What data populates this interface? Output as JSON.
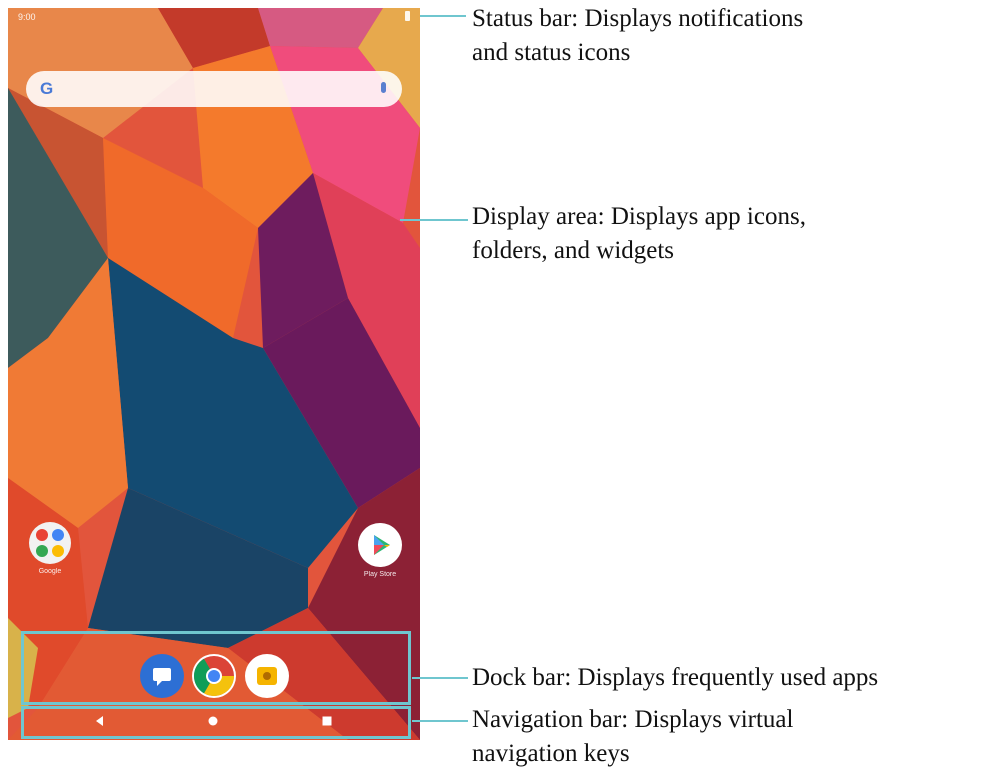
{
  "phone": {
    "status_bar": {
      "time": "9:00"
    },
    "apps": [
      {
        "id": "folder",
        "label": "Google"
      },
      {
        "id": "play-store",
        "label": "Play Store"
      }
    ],
    "dock": [
      {
        "id": "messages-icon"
      },
      {
        "id": "chrome-icon"
      },
      {
        "id": "gallery-icon"
      }
    ],
    "nav_keys": [
      "back-icon",
      "home-icon",
      "recents-icon"
    ]
  },
  "annotations": [
    {
      "key": "status_bar",
      "line1": "Status bar: Displays notifications",
      "line2": "and status icons"
    },
    {
      "key": "display_area",
      "line1": "Display area: Displays app icons,",
      "line2": "folders, and widgets"
    },
    {
      "key": "dock_bar",
      "line1": "Dock bar: Displays frequently used apps",
      "line2": ""
    },
    {
      "key": "navigation_bar",
      "line1": "Navigation bar: Displays virtual",
      "line2": "navigation keys"
    }
  ],
  "colors": {
    "annotation_accent": "#6fc6cf",
    "annotation_text": "#111111"
  }
}
